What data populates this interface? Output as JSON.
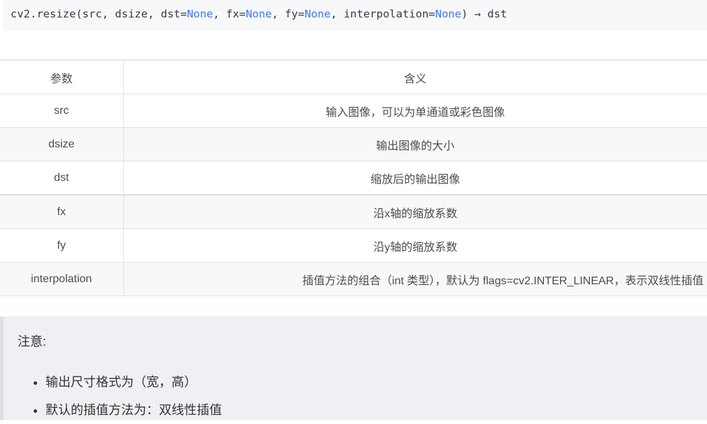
{
  "code": {
    "prefix": "cv2.resize(src, dsize, dst=",
    "kw1": "None",
    "mid1": ", fx=",
    "kw2": "None",
    "mid2": ", fy=",
    "kw3": "None",
    "mid3": ", interpolation=",
    "kw4": "None",
    "suffix": ") → dst"
  },
  "table": {
    "headers": [
      "参数",
      "含义"
    ],
    "rows": [
      {
        "param": "src",
        "meaning": "输入图像，可以为单通道或彩色图像"
      },
      {
        "param": "dsize",
        "meaning": "输出图像的大小"
      },
      {
        "param": "dst",
        "meaning": "缩放后的输出图像"
      },
      {
        "param": "fx",
        "meaning": "沿x轴的缩放系数"
      },
      {
        "param": "fy",
        "meaning": "沿y轴的缩放系数"
      },
      {
        "param": "interpolation",
        "meaning": "插值方法的组合（int 类型），默认为 flags=cv2.INTER_LINEAR，表示双线性插值"
      }
    ]
  },
  "note": {
    "title": "注意:",
    "items": [
      "输出尺寸格式为（宽，高）",
      "默认的插值方法为：双线性插值"
    ]
  },
  "colors": {
    "keyword": "#4078f2",
    "code_bg": "#f6f8fa",
    "note_bg": "#eef0f4"
  }
}
